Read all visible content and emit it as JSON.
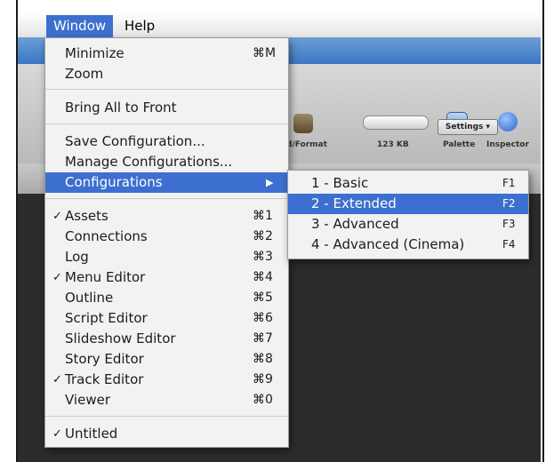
{
  "menubar": {
    "items": [
      {
        "label": "Window"
      },
      {
        "label": "Help"
      }
    ]
  },
  "toolbar": {
    "labels": {
      "format": "d/Format",
      "size": "123 KB",
      "palette": "Palette",
      "inspector": "Inspector"
    },
    "settings_label": "Settings ▾"
  },
  "window_menu": {
    "items": [
      {
        "label": "Minimize",
        "shortcut": "⌘M",
        "checked": ""
      },
      {
        "label": "Zoom",
        "shortcut": "",
        "checked": ""
      },
      {
        "label": "Bring All to Front",
        "shortcut": "",
        "checked": ""
      },
      {
        "label": "Save Configuration...",
        "shortcut": "",
        "checked": ""
      },
      {
        "label": "Manage Configurations...",
        "shortcut": "",
        "checked": ""
      },
      {
        "label": "Configurations",
        "shortcut": "",
        "checked": "",
        "arrow": "▶"
      },
      {
        "label": "Assets",
        "shortcut": "⌘1",
        "checked": "✓"
      },
      {
        "label": "Connections",
        "shortcut": "⌘2",
        "checked": ""
      },
      {
        "label": "Log",
        "shortcut": "⌘3",
        "checked": ""
      },
      {
        "label": "Menu Editor",
        "shortcut": "⌘4",
        "checked": "✓"
      },
      {
        "label": "Outline",
        "shortcut": "⌘5",
        "checked": ""
      },
      {
        "label": "Script Editor",
        "shortcut": "⌘6",
        "checked": ""
      },
      {
        "label": "Slideshow Editor",
        "shortcut": "⌘7",
        "checked": ""
      },
      {
        "label": "Story Editor",
        "shortcut": "⌘8",
        "checked": ""
      },
      {
        "label": "Track Editor",
        "shortcut": "⌘9",
        "checked": "✓"
      },
      {
        "label": "Viewer",
        "shortcut": "⌘0",
        "checked": ""
      },
      {
        "label": "Untitled",
        "shortcut": "",
        "checked": "✓"
      }
    ]
  },
  "configurations_submenu": {
    "items": [
      {
        "label": "1 - Basic",
        "shortcut": "F1"
      },
      {
        "label": "2 - Extended",
        "shortcut": "F2"
      },
      {
        "label": "3 - Advanced",
        "shortcut": "F3"
      },
      {
        "label": "4 - Advanced (Cinema)",
        "shortcut": "F4"
      }
    ]
  },
  "colors": {
    "highlight": "#3c6fcf",
    "menu_bg": "#f2f2f2",
    "app_dark": "#2c2c2c"
  }
}
